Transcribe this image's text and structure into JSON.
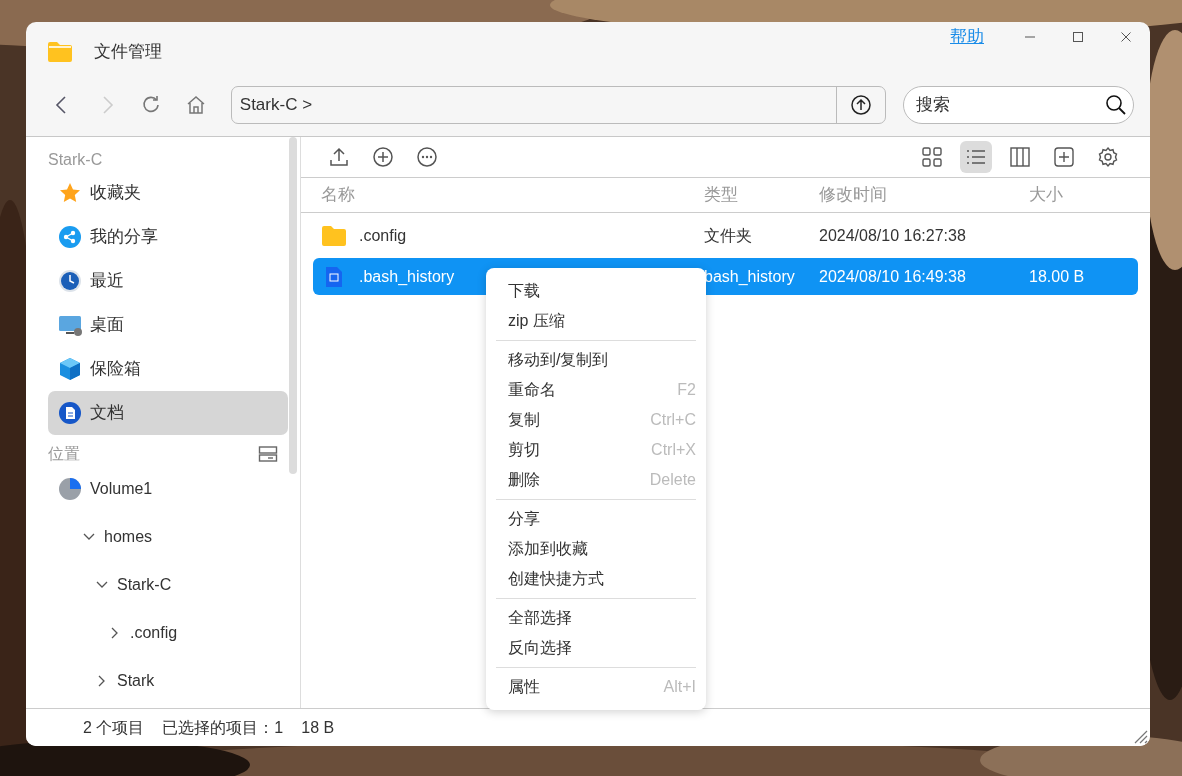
{
  "window": {
    "title": "文件管理",
    "help_link": "帮助"
  },
  "nav": {
    "back_disabled": false,
    "forward_disabled": true,
    "path": "Stark-C",
    "path_chevron": ">",
    "search": {
      "placeholder": "搜索"
    }
  },
  "sidebar": {
    "section_title": "Stark-C",
    "items": [
      {
        "label": "收藏夹",
        "kind": "favorites",
        "selected": false
      },
      {
        "label": "我的分享",
        "kind": "shared",
        "selected": false
      },
      {
        "label": "最近",
        "kind": "recent",
        "selected": false
      },
      {
        "label": "桌面",
        "kind": "desktop",
        "selected": false
      },
      {
        "label": "保险箱",
        "kind": "vault",
        "selected": false
      },
      {
        "label": "文档",
        "kind": "documents",
        "selected": true
      }
    ],
    "location_title": "位置",
    "tree": [
      {
        "label": "Volume1",
        "kind": "volume",
        "children": [
          {
            "label": "homes",
            "expanded": true,
            "children": [
              {
                "label": "Stark-C",
                "expanded": true,
                "children": [
                  {
                    "label": ".config",
                    "expanded": false
                  }
                ]
              },
              {
                "label": "Stark",
                "expanded": false
              }
            ]
          }
        ]
      }
    ]
  },
  "toolbar": {
    "view_buttons": [
      {
        "kind": "grid",
        "selected": false
      },
      {
        "kind": "list",
        "selected": true
      },
      {
        "kind": "columns",
        "selected": false
      },
      {
        "kind": "add-panel",
        "selected": false
      },
      {
        "kind": "settings",
        "selected": false
      }
    ]
  },
  "table": {
    "columns": [
      "名称",
      "类型",
      "修改时间",
      "大小"
    ],
    "rows": [
      {
        "kind": "folder",
        "name": ".config",
        "type": "文件夹",
        "modified": "2024/08/10 16:27:38",
        "selected": false
      },
      {
        "kind": "file",
        "name": ".bash_history",
        "type": "bash_history",
        "modified": "2024/08/10 16:49:38",
        "size": "18.00 B",
        "selected": true
      }
    ]
  },
  "context_menu": {
    "sections": [
      [
        {
          "label": "下载"
        },
        {
          "label": "zip 压缩"
        }
      ],
      [
        {
          "label": "移动到/复制到"
        },
        {
          "label": "重命名",
          "shortcut": "F2"
        },
        {
          "label": "复制",
          "shortcut": "Ctrl+C"
        },
        {
          "label": "剪切",
          "shortcut": "Ctrl+X"
        },
        {
          "label": "删除",
          "shortcut": "Delete"
        }
      ],
      [
        {
          "label": "分享"
        },
        {
          "label": "添加到收藏"
        },
        {
          "label": "创建快捷方式"
        }
      ],
      [
        {
          "label": "全部选择"
        },
        {
          "label": "反向选择"
        }
      ],
      [
        {
          "label": "属性",
          "shortcut": "Alt+I"
        }
      ]
    ]
  },
  "status_bar": {
    "item_count": "2 个项目",
    "selected_count": "已选择的项目：1",
    "selected_size": "18 B"
  }
}
